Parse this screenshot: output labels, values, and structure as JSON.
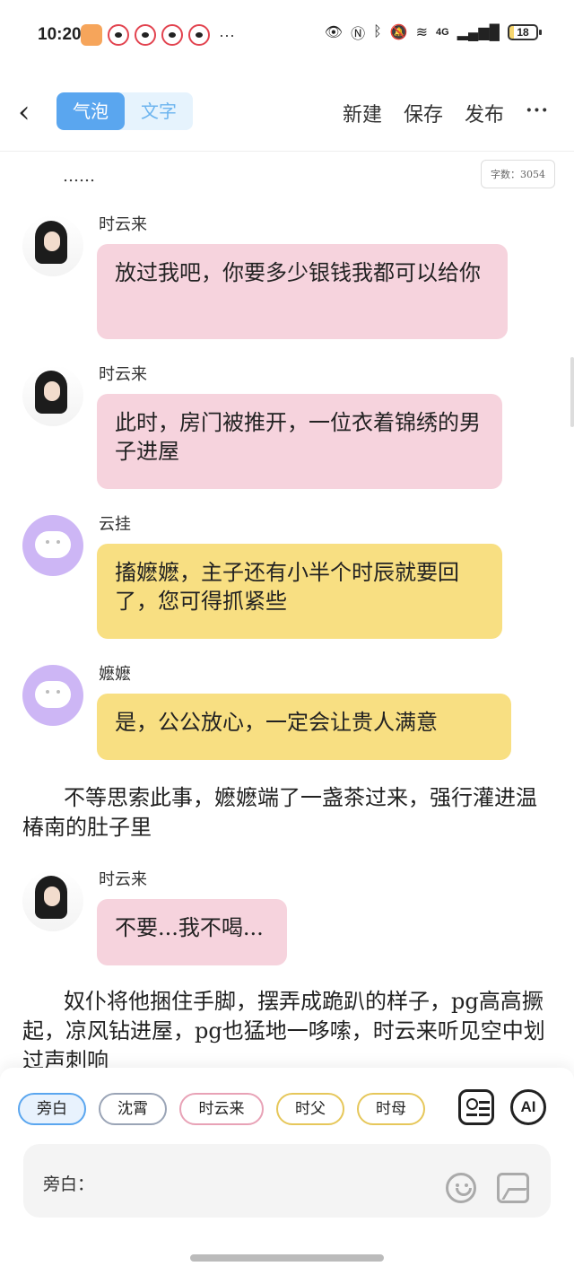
{
  "status": {
    "time": "10:20",
    "notifications": [
      "heart-app",
      "weibo",
      "weibo",
      "weibo",
      "weibo"
    ],
    "more": "···",
    "network": "4G",
    "battery": "18"
  },
  "nav": {
    "tabs": [
      "气泡",
      "文字"
    ],
    "active_tab": "气泡",
    "actions": [
      "新建",
      "保存",
      "发布"
    ],
    "more": "···"
  },
  "word_count": "字数：3054",
  "ellipsis": "……",
  "messages": [
    {
      "speaker": "时云来",
      "text": "放过我吧，你要多少银钱我都可以给你",
      "style": "pink"
    },
    {
      "speaker": "时云来",
      "text": "此时，房门被推开，一位衣着锦绣的男子进屋",
      "style": "pink"
    },
    {
      "speaker": "云挂",
      "text": "搐嬷嬷，主子还有小半个时辰就要回了，您可得抓紧些",
      "style": "yellow"
    },
    {
      "speaker": "嬷嬷",
      "text": "是，公公放心，一定会让贵人满意",
      "style": "yellow"
    },
    {
      "speaker": "时云来",
      "text": "不要...我不喝...",
      "style": "pink"
    }
  ],
  "narration": [
    "不等思索此事，嬷嬷端了一盏茶过来，强行灌进温椿南的肚子里",
    "奴仆将他捆住手脚，摆弄成跪趴的样子，pg高高撅起，凉风钻进屋，pg也猛地一哆嗦，时云来听见空中划过声刺响"
  ],
  "bottom": {
    "chips": [
      "旁白",
      "沈霄",
      "时云来",
      "时父",
      "时母"
    ],
    "ai_label": "AI",
    "input_label": "旁白："
  },
  "colors": {
    "accent": "#5aa6ef",
    "pink_bubble": "#f6d3dd",
    "yellow_bubble": "#f8df82",
    "avatar_purple": "#cdb6f5"
  }
}
